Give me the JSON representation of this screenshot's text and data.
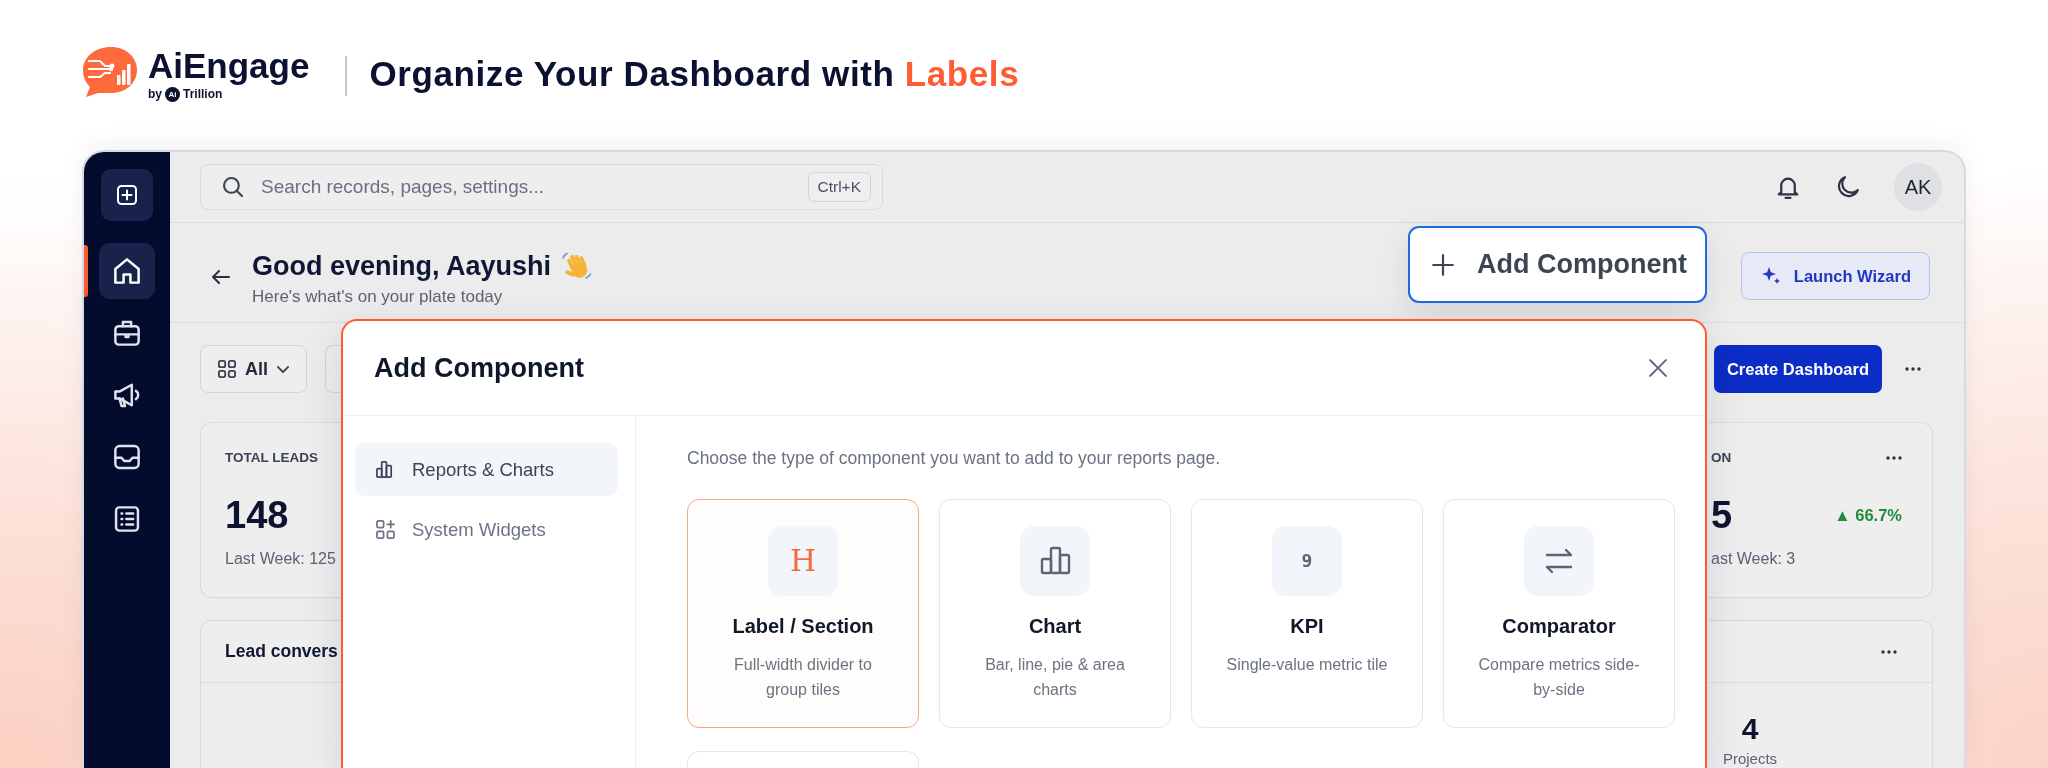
{
  "header": {
    "brand": {
      "name": "AiEngage",
      "by": "by",
      "badge": "Ai",
      "company": "Trillion"
    },
    "title": "Organize Your Dashboard with",
    "title_highlight": "Labels"
  },
  "sidebar": {
    "items": [
      {
        "kind": "home",
        "selected": true
      },
      {
        "kind": "briefcase",
        "selected": false
      },
      {
        "kind": "megaphone",
        "selected": false
      },
      {
        "kind": "inbox",
        "selected": false
      },
      {
        "kind": "checklist",
        "selected": false
      }
    ]
  },
  "topbar": {
    "search": {
      "placeholder": "Search records, pages, settings...",
      "shortcut": "Ctrl+K"
    },
    "avatar": "AK"
  },
  "page_header": {
    "greeting": "Good evening, Aayushi",
    "subtitle": "Here's what's on your plate today",
    "highlighted_action": "Add Component",
    "action": "Launch Wizard"
  },
  "toolbar": {
    "filter": "All",
    "primary_button": "Create Dashboard"
  },
  "kpi_cards": [
    {
      "label": "TOTAL LEADS",
      "value": "148",
      "note": "Last Week: 125"
    },
    {
      "label": "ON",
      "value": "5",
      "note": "ast Week: 3",
      "change": "▲ 66.7%"
    }
  ],
  "panels": [
    {
      "title": "Lead convers"
    },
    {
      "value": "4",
      "caption": "Projects"
    }
  ],
  "modal": {
    "title": "Add Component",
    "nav": [
      {
        "kind": "chart",
        "label": "Reports & Charts",
        "selected": true
      },
      {
        "kind": "widgets",
        "label": "System Widgets",
        "selected": false
      }
    ],
    "intro": "Choose the type of component you want to add to your reports page.",
    "tiles": [
      {
        "kind": "heading",
        "glyph": "H",
        "title": "Label / Section",
        "description": "Full-width divider to group tiles",
        "selected": true
      },
      {
        "kind": "chart",
        "title": "Chart",
        "description": "Bar, line, pie & area charts",
        "selected": false
      },
      {
        "kind": "number",
        "glyph": "9",
        "title": "KPI",
        "description": "Single-value metric tile",
        "selected": false
      },
      {
        "kind": "compare",
        "title": "Comparator",
        "description": "Compare metrics side-by-side",
        "selected": false
      },
      {
        "kind": "partial",
        "selected": false
      }
    ]
  }
}
